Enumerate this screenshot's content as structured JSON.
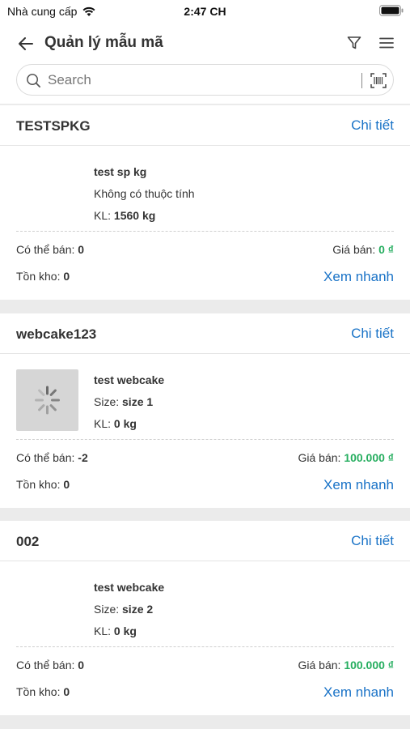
{
  "status": {
    "carrier": "Nhà cung cấp",
    "time": "2:47 CH"
  },
  "header": {
    "title": "Quản lý mẫu mã"
  },
  "search": {
    "placeholder": "Search"
  },
  "labels": {
    "detail": "Chi tiết",
    "available": "Có thể bán:",
    "price": "Giá bán:",
    "stock": "Tồn kho:",
    "quick_view": "Xem nhanh",
    "weight": "KL:"
  },
  "products": [
    {
      "sku": "TESTSPKG",
      "name": "test sp kg",
      "attribute": "Không có thuộc tính",
      "attr_label": "",
      "attr_value": "",
      "weight": "1560 kg",
      "available": "0",
      "price": "0 ₫",
      "stock": "0",
      "has_image": false
    },
    {
      "sku": "webcake123",
      "name": "test webcake",
      "attribute": "",
      "attr_label": "Size:",
      "attr_value": "size 1",
      "weight": "0 kg",
      "available": "-2",
      "price": "100.000 ₫",
      "stock": "0",
      "has_image": true
    },
    {
      "sku": "002",
      "name": "test webcake",
      "attribute": "",
      "attr_label": "Size:",
      "attr_value": "size 2",
      "weight": "0 kg",
      "available": "0",
      "price": "100.000 ₫",
      "stock": "0",
      "has_image": false
    }
  ],
  "icons": {
    "back": "arrow-left-icon",
    "filter": "filter-icon",
    "menu": "menu-icon",
    "search": "search-icon",
    "barcode": "barcode-scan-icon",
    "loading": "loading-spinner-icon"
  },
  "colors": {
    "link": "#1a73c7",
    "price": "#27ae60",
    "background": "#ebebeb"
  }
}
